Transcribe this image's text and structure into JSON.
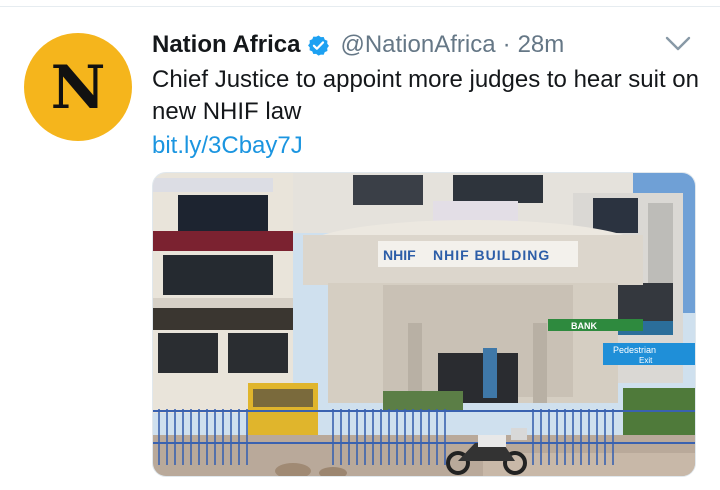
{
  "tweet": {
    "author_name": "Nation Africa",
    "handle": "@NationAfrica",
    "separator": "·",
    "time": "28m",
    "text": "Chief Justice to appoint more judges to hear suit on new NHIF law",
    "link": "bit.ly/3Cbay7J",
    "avatar_letter": "N",
    "verified_icon": "verified-badge-icon",
    "more_icon": "chevron-down-icon"
  },
  "photo": {
    "building_sign": "NHIF BUILDING",
    "small_sign": "NHIF",
    "street_sign_1": "Pedestrian",
    "street_sign_2": "Exit",
    "bank_sign": "BANK"
  },
  "colors": {
    "avatar_bg": "#f5b51c",
    "link": "#1b95e0",
    "verified": "#1da1f2",
    "muted": "#657786"
  }
}
